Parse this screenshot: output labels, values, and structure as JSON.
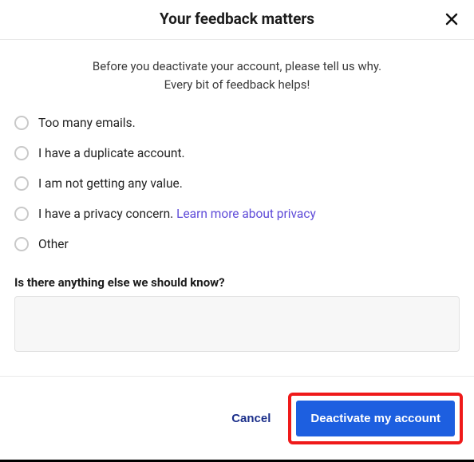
{
  "header": {
    "title": "Your feedback matters"
  },
  "subtitle": {
    "line1": "Before you deactivate your account, please tell us why.",
    "line2": "Every bit of feedback helps!"
  },
  "options": [
    {
      "label": "Too many emails."
    },
    {
      "label": "I have a duplicate account."
    },
    {
      "label": "I am not getting any value."
    },
    {
      "label": "I have a privacy concern. ",
      "link": "Learn more about privacy"
    },
    {
      "label": "Other"
    }
  ],
  "freeform": {
    "prompt": "Is there anything else we should know?",
    "value": ""
  },
  "footer": {
    "cancel": "Cancel",
    "deactivate": "Deactivate my account"
  }
}
